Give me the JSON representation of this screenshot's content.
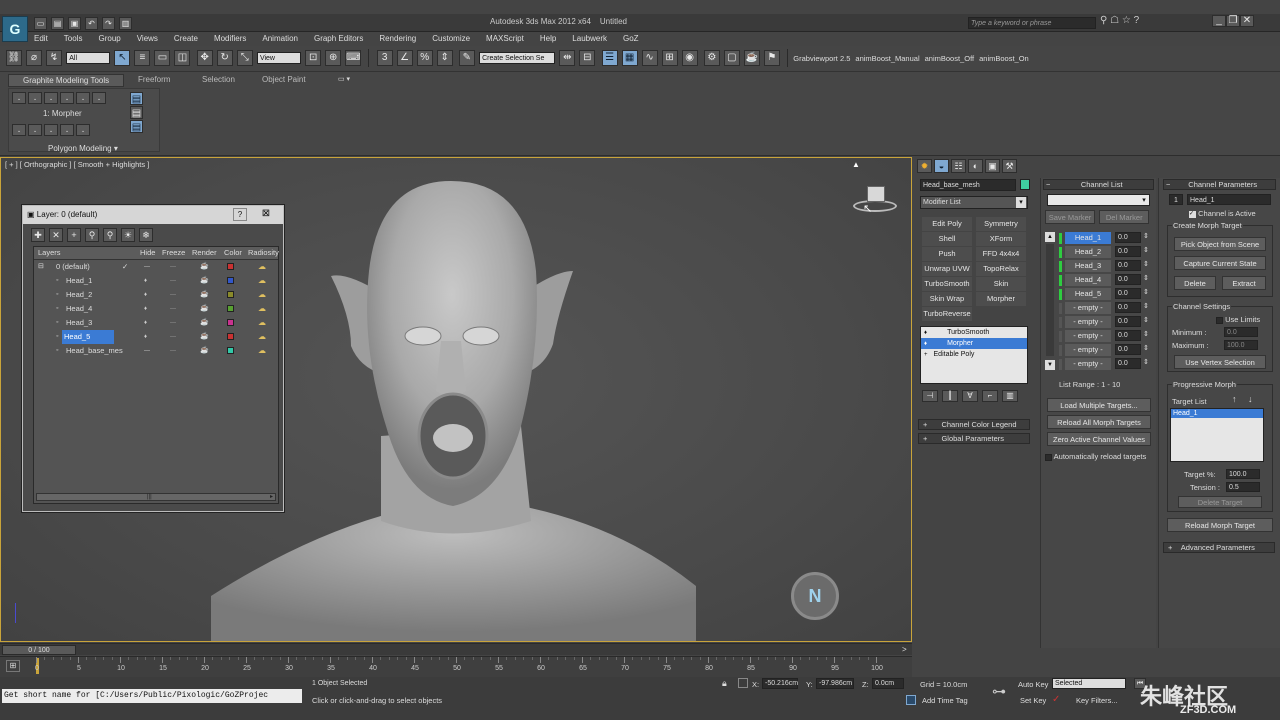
{
  "title": {
    "app": "Autodesk 3ds Max 2012 x64",
    "doc": "Untitled",
    "search_placeholder": "Type a keyword or phrase"
  },
  "menu": [
    "Edit",
    "Tools",
    "Group",
    "Views",
    "Create",
    "Modifiers",
    "Animation",
    "Graph Editors",
    "Rendering",
    "Customize",
    "MAXScript",
    "Help",
    "Laubwerk",
    "GoZ"
  ],
  "toolbar": {
    "selection_filter": "All",
    "ref_coord": "View",
    "named_selection": "Create Selection Se",
    "plugins": [
      "Grabviewport 2.5",
      "animBoost_Manual",
      "animBoost_Off",
      "animBoost_On"
    ]
  },
  "ribbon": {
    "tabs": [
      "Graphite Modeling Tools",
      "Freeform",
      "Selection",
      "Object Paint"
    ],
    "modifier_label": "1: Morpher",
    "panel_label": "Polygon Modeling"
  },
  "viewport": {
    "label": "[ + ] [ Orthographic ] [ Smooth + Highlights ]"
  },
  "layer_dialog": {
    "title": "Layer: 0 (default)",
    "help": "?",
    "close": "⊠",
    "columns": [
      "Layers",
      "Hide",
      "Freeze",
      "Render",
      "Color",
      "Radiosity"
    ],
    "rows": [
      {
        "name": "0 (default)",
        "check": "✓",
        "color": "#c93232"
      },
      {
        "name": "Head_1",
        "color": "#3257c9"
      },
      {
        "name": "Head_2",
        "color": "#8a8a2a"
      },
      {
        "name": "Head_4",
        "color": "#58a032"
      },
      {
        "name": "Head_3",
        "color": "#c9328f"
      },
      {
        "name": "Head_5",
        "color": "#c93232"
      },
      {
        "name": "Head_base_mes",
        "color": "#32c9a8"
      }
    ]
  },
  "command_panel": {
    "object_name": "Head_base_mesh",
    "object_color": "#3fcf9f",
    "modifier_list": "Modifier List",
    "mod_buttons": [
      "Edit Poly",
      "Symmetry",
      "Shell",
      "XForm",
      "Push",
      "FFD 4x4x4",
      "Unwrap UVW",
      "TopoRelax",
      "TurboSmooth",
      "Skin",
      "Skin Wrap",
      "Morpher",
      "TurboReverse"
    ],
    "stack": [
      "TurboSmooth",
      "Morpher",
      "Editable Poly"
    ],
    "rollouts": [
      "Channel Color Legend",
      "Global Parameters"
    ]
  },
  "channel_list": {
    "header": "Channel List",
    "save_marker": "Save Marker",
    "del_marker": "Del Marker",
    "channels": [
      {
        "name": "Head_1",
        "value": "0.0",
        "active": true
      },
      {
        "name": "Head_2",
        "value": "0.0"
      },
      {
        "name": "Head_3",
        "value": "0.0"
      },
      {
        "name": "Head_4",
        "value": "0.0"
      },
      {
        "name": "Head_5",
        "value": "0.0"
      },
      {
        "name": "- empty -",
        "value": "0.0"
      },
      {
        "name": "- empty -",
        "value": "0.0"
      },
      {
        "name": "- empty -",
        "value": "0.0"
      },
      {
        "name": "- empty -",
        "value": "0.0"
      },
      {
        "name": "- empty -",
        "value": "0.0"
      }
    ],
    "list_range": "List Range :   1 - 10",
    "load_multiple": "Load Multiple Targets...",
    "reload_all": "Reload All Morph Targets",
    "zero_active": "Zero Active Channel Values",
    "auto_reload": "Automatically reload targets"
  },
  "channel_params": {
    "header": "Channel Parameters",
    "index": "1",
    "name": "Head_1",
    "active_label": "Channel is Active",
    "create_label": "Create Morph Target",
    "pick": "Pick Object from Scene",
    "capture": "Capture Current State",
    "delete": "Delete",
    "extract": "Extract",
    "settings_label": "Channel Settings",
    "use_limits": "Use Limits",
    "min_label": "Minimum :",
    "min_value": "0.0",
    "max_label": "Maximum :",
    "max_value": "100.0",
    "use_vertex": "Use Vertex Selection",
    "prog_label": "Progressive Morph",
    "target_list_label": "Target List",
    "target_item": "Head_1",
    "target_pct_label": "Target %:",
    "target_pct": "100.0",
    "tension_label": "Tension :",
    "tension": "0.5",
    "delete_target": "Delete Target",
    "reload_target": "Reload Morph Target",
    "advanced": "Advanced Parameters"
  },
  "timeline": {
    "frame": "0 / 100",
    "ticks": [
      "0",
      "5",
      "10",
      "15",
      "20",
      "25",
      "30",
      "35",
      "40",
      "45",
      "50",
      "55",
      "60",
      "65",
      "70",
      "75",
      "80",
      "85",
      "90",
      "95",
      "100"
    ],
    "time_progress": 0
  },
  "status": {
    "maxscript": "Get short name for [C:/Users/Public/Pixologic/GoZProjec",
    "selected": "1 Object Selected",
    "prompt": "Click or click-and-drag to select objects",
    "x_label": "X:",
    "x": "-50.216cm",
    "y_label": "Y:",
    "y": "-97.986cm",
    "z_label": "Z:",
    "z": "0.0cm",
    "grid": "Grid = 10.0cm",
    "add_tag": "Add Time Tag",
    "auto_key": "Auto Key",
    "set_key": "Set Key",
    "key_mode": "Selected",
    "key_filters": "Key Filters...",
    "watermark": "ZF3D.COM",
    "watermark_cn": "朱峰社区"
  }
}
